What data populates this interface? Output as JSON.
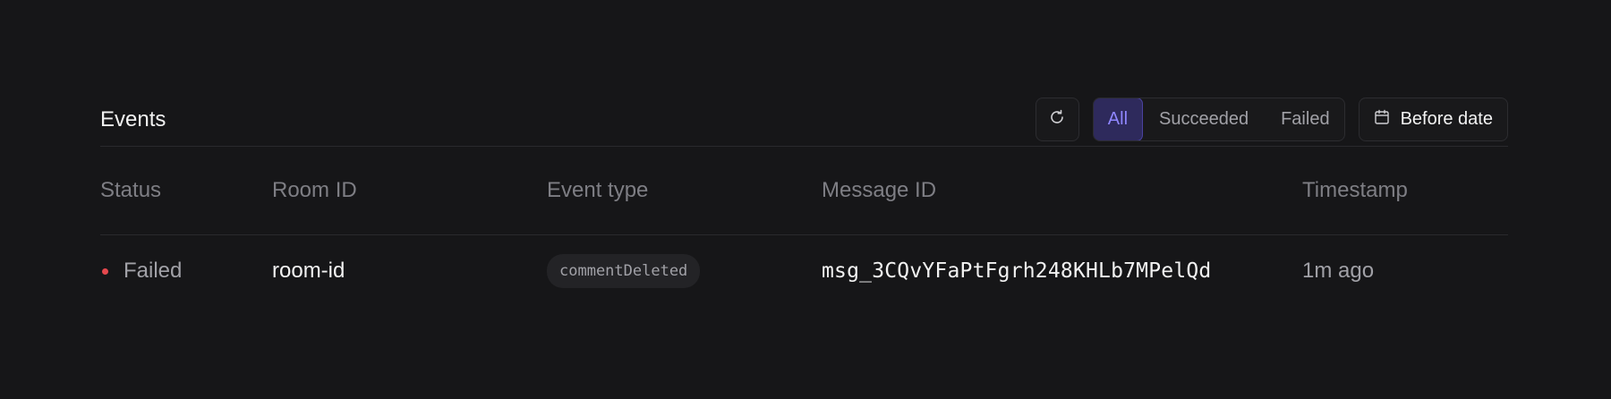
{
  "header": {
    "title": "Events"
  },
  "filters": {
    "options": [
      "All",
      "Succeeded",
      "Failed"
    ],
    "selected": "All",
    "date_label": "Before date"
  },
  "table": {
    "columns": [
      "Status",
      "Room ID",
      "Event type",
      "Message ID",
      "Timestamp"
    ],
    "rows": [
      {
        "status": "Failed",
        "room_id": "room-id",
        "event_type": "commentDeleted",
        "message_id": "msg_3CQvYFaPtFgrh248KHLb7MPelQd",
        "timestamp": "1m ago"
      }
    ]
  },
  "colors": {
    "background": "#161618",
    "accent": "#8f86ff",
    "accent_bg": "#2e2a5c",
    "status_failed": "#e5484d"
  },
  "icons": {
    "refresh": "refresh-icon",
    "calendar": "calendar-icon"
  }
}
